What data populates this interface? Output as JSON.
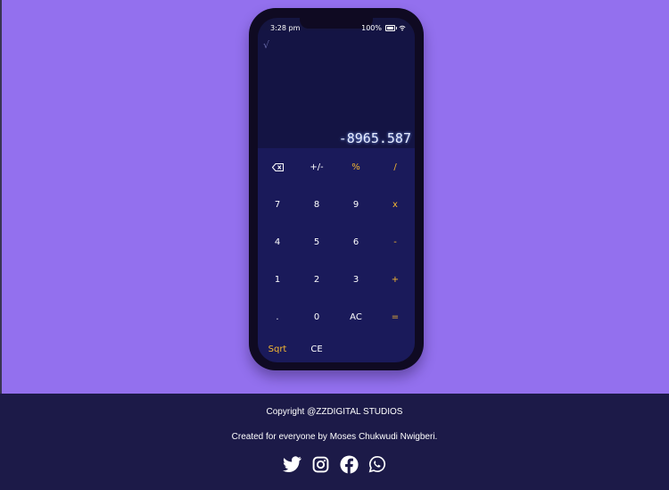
{
  "status": {
    "time": "3:28 pm",
    "battery": "100%"
  },
  "display": {
    "operation_symbol": "√",
    "value": "-8965.587"
  },
  "keypad": {
    "backspace": "⌫",
    "plusminus": "+/-",
    "percent": "%",
    "divide": "/",
    "seven": "7",
    "eight": "8",
    "nine": "9",
    "multiply": "x",
    "four": "4",
    "five": "5",
    "six": "6",
    "minus": "-",
    "one": "1",
    "two": "2",
    "three": "3",
    "plus": "+",
    "dot": ".",
    "zero": "0",
    "ac": "AC",
    "equals": "=",
    "sqrt": "Sqrt",
    "ce": "CE"
  },
  "footer": {
    "copyright": "Copyright @ZZDIGITAL STUDIOS",
    "credit": "Created for everyone by Moses Chukwudi Nwigberi."
  },
  "socials": [
    {
      "icon": "twitter-icon"
    },
    {
      "icon": "instagram-icon"
    },
    {
      "icon": "facebook-icon"
    },
    {
      "icon": "whatsapp-icon"
    }
  ],
  "colors": {
    "background": "#9370ee",
    "phone": "#0f0a22",
    "keypad": "#1a1a5a",
    "accent": "#f5b731",
    "footer": "#1c1a48"
  }
}
